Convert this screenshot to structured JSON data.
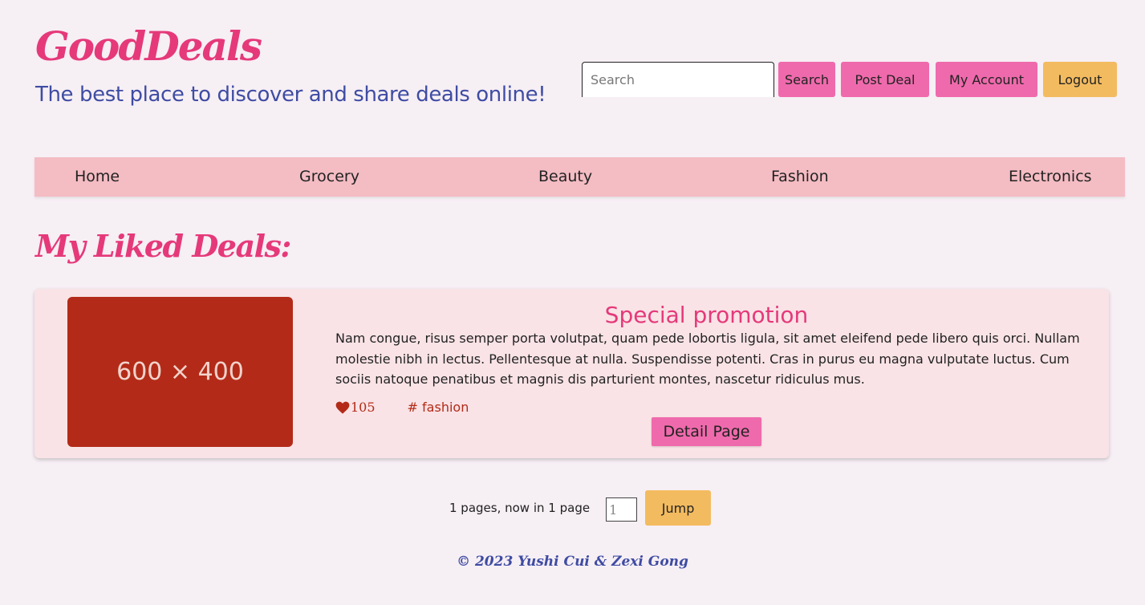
{
  "brand": {
    "title": "GoodDeals",
    "tagline": "The best place to discover and share deals online!"
  },
  "header": {
    "search_placeholder": "Search",
    "search_label": "Search",
    "post_label": "Post Deal",
    "account_label": "My Account",
    "logout_label": "Logout"
  },
  "nav": {
    "items": [
      {
        "label": "Home"
      },
      {
        "label": "Grocery"
      },
      {
        "label": "Beauty"
      },
      {
        "label": "Fashion"
      },
      {
        "label": "Electronics"
      }
    ]
  },
  "main": {
    "section_title": "My Liked Deals:",
    "deals": [
      {
        "image_text": "600 × 400",
        "image_color": "#b32b18",
        "title": "Special promotion",
        "description": "Nam congue, risus semper porta volutpat, quam pede lobortis ligula, sit amet eleifend pede libero quis orci. Nullam molestie nibh in lectus. Pellentesque at nulla. Suspendisse potenti. Cras in purus eu magna vulputate luctus. Cum sociis natoque penatibus et magnis dis parturient montes, nascetur ridiculus mus.",
        "likes": "105",
        "like_icon": "heart-icon",
        "tag": "# fashion",
        "detail_label": "Detail Page"
      }
    ]
  },
  "pagination": {
    "info": "1 pages, now in 1 page",
    "page_value": "1",
    "jump_label": "Jump"
  },
  "footer": {
    "text": "© 2023 Yushi Cui & Zexi Gong"
  },
  "colors": {
    "accent_pink": "#e5397a",
    "button_pink": "#ef6aac",
    "button_orange": "#f3bb60",
    "nav_bg": "#f4bcc3",
    "tagline_blue": "#3f4ca3",
    "card_bg": "#f9e3e6"
  }
}
